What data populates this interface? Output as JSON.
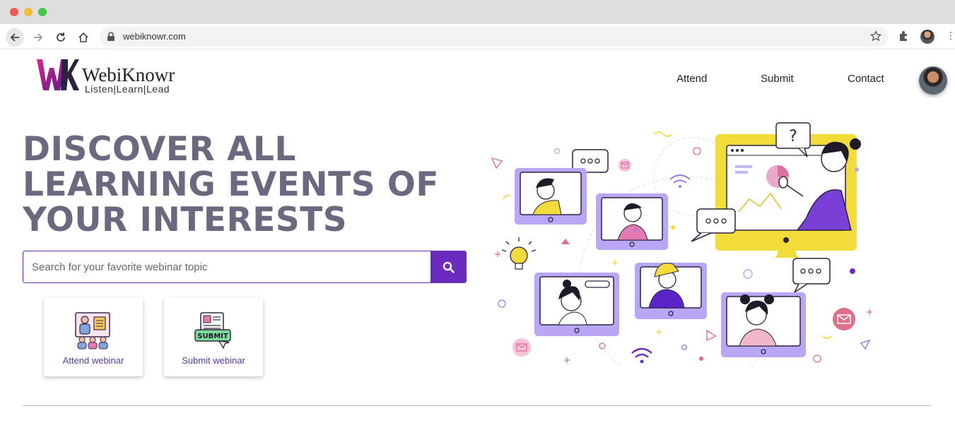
{
  "browser": {
    "url": "webiknowr.com"
  },
  "header": {
    "logo_name": "WebiKnowr",
    "logo_tagline": "Listen|Learn|Lead",
    "nav": [
      {
        "label": "Attend"
      },
      {
        "label": "Submit"
      },
      {
        "label": "Contact"
      }
    ]
  },
  "hero": {
    "title_lines": [
      "DISCOVER ALL",
      "LEARNING EVENTS OF",
      "YOUR INTERESTS"
    ]
  },
  "search": {
    "placeholder": "Search for your favorite webinar topic",
    "value": ""
  },
  "cards": [
    {
      "label": "Attend webinar",
      "icon": "attend-webinar-icon"
    },
    {
      "label": "Submit webinar",
      "icon": "submit-webinar-icon",
      "icon_text": "SUBMIT"
    }
  ],
  "colors": {
    "accent": "#6c2bc0",
    "title": "#6b6880",
    "illustration_purple": "#b9a6f5",
    "illustration_yellow": "#f1dc3a"
  }
}
